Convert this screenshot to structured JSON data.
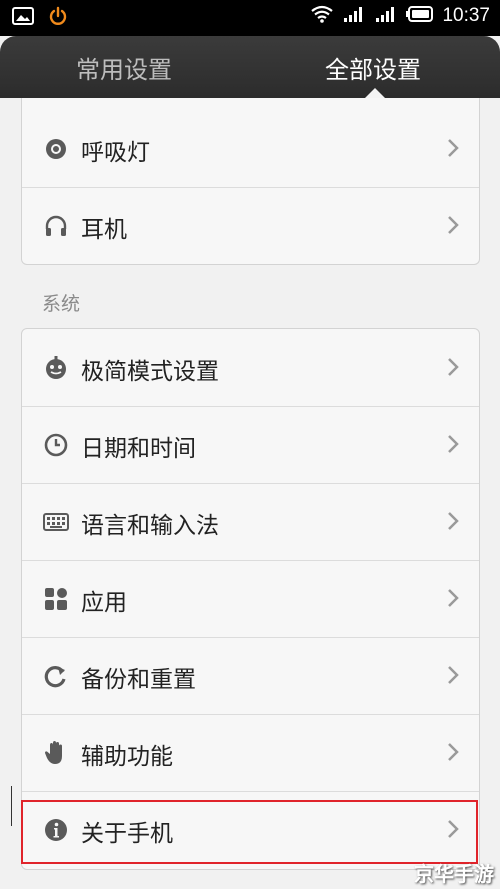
{
  "status_bar": {
    "time": "10:37",
    "icons": [
      "gallery-icon",
      "power-icon",
      "wifi-icon",
      "signal-icon",
      "signal-icon",
      "battery-icon"
    ]
  },
  "tabs": {
    "common": "常用设置",
    "all": "全部设置",
    "active": "all"
  },
  "top_group": {
    "items": [
      {
        "label": "呼吸灯",
        "icon": "breathing-light-icon"
      },
      {
        "label": "耳机",
        "icon": "headphones-icon"
      }
    ]
  },
  "system": {
    "title": "系统",
    "items": [
      {
        "label": "极简模式设置",
        "icon": "simple-mode-icon"
      },
      {
        "label": "日期和时间",
        "icon": "clock-icon"
      },
      {
        "label": "语言和输入法",
        "icon": "keyboard-icon"
      },
      {
        "label": "应用",
        "icon": "apps-icon"
      },
      {
        "label": "备份和重置",
        "icon": "backup-icon"
      },
      {
        "label": "辅助功能",
        "icon": "hand-icon"
      },
      {
        "label": "关于手机",
        "icon": "info-icon"
      }
    ]
  },
  "watermark": "京华手游",
  "colors": {
    "highlight": "#e0242b",
    "header": "#2c2c2c",
    "icon": "#5a5a5a"
  }
}
